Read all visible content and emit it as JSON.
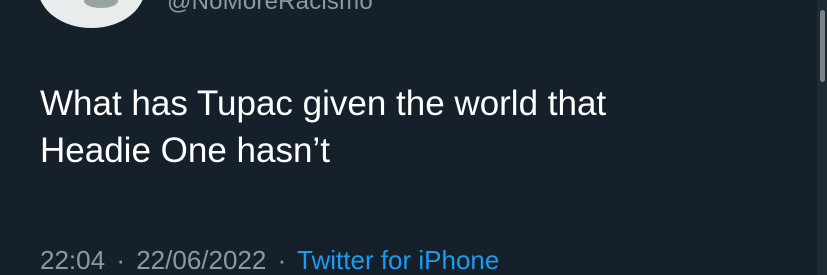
{
  "author": {
    "handle": "@NoMoreRacismo"
  },
  "tweet": {
    "text_line1": "What has Tupac given the world that",
    "text_line2": "Headie One hasn’t"
  },
  "meta": {
    "time": "22:04",
    "separator": "·",
    "date": "22/06/2022",
    "source": "Twitter for iPhone"
  },
  "colors": {
    "background": "#15202b",
    "text": "#ffffff",
    "muted": "#8b98a5",
    "link": "#1d9bf0"
  },
  "icons": [
    "avatar-image"
  ]
}
